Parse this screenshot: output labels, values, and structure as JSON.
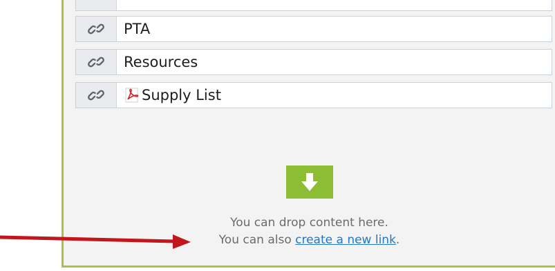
{
  "links": [
    {
      "label": "",
      "icon": "link-icon",
      "partial": true
    },
    {
      "label": "PTA",
      "icon": "link-icon"
    },
    {
      "label": "Resources",
      "icon": "link-icon"
    },
    {
      "label": "Supply List",
      "icon": "link-icon",
      "file_icon": "pdf-icon"
    }
  ],
  "drop_zone": {
    "icon": "down-arrow-icon",
    "line1": "You can drop content here.",
    "line2_prefix": "You can also ",
    "link_text": "create a new link",
    "line2_suffix": "."
  },
  "colors": {
    "accent_green": "#8dbd35",
    "panel_border": "#a9c23f",
    "link_blue": "#2277c6",
    "annotation_red": "#c0161c"
  }
}
